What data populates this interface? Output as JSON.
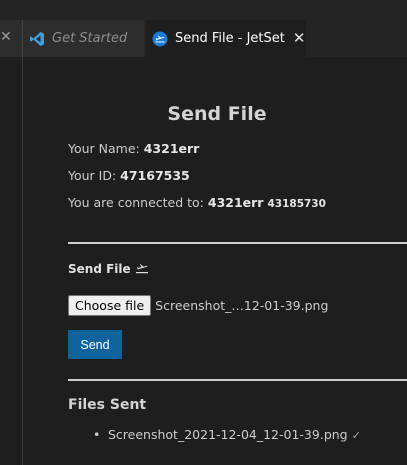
{
  "tabs": {
    "stub_close": "✕",
    "get_started": {
      "label": "Get Started",
      "icon": "vscode-logo-icon",
      "color": "#3b9fe0"
    },
    "send_file": {
      "label": "Send File - JetSet",
      "icon": "jetset-logo-icon",
      "close": "✕",
      "color": "#1a7bd6"
    }
  },
  "page": {
    "title": "Send File",
    "name_label": "Your Name: ",
    "name_value": "4321err",
    "id_label": "Your ID: ",
    "id_value": "47167535",
    "connected_label": "You are connected to: ",
    "connected_name": "4321err",
    "connected_id": "43185730"
  },
  "send_section": {
    "label": "Send File",
    "icon": "airplane-icon",
    "choose_file_label": "Choose file",
    "file_name": "Screenshot_…12-01-39.png",
    "send_label": "Send",
    "accent": "#0e639c"
  },
  "files_sent": {
    "title": "Files Sent",
    "items": [
      {
        "name": "Screenshot_2021-12-04_12-01-39.png",
        "status": "✓"
      }
    ]
  }
}
